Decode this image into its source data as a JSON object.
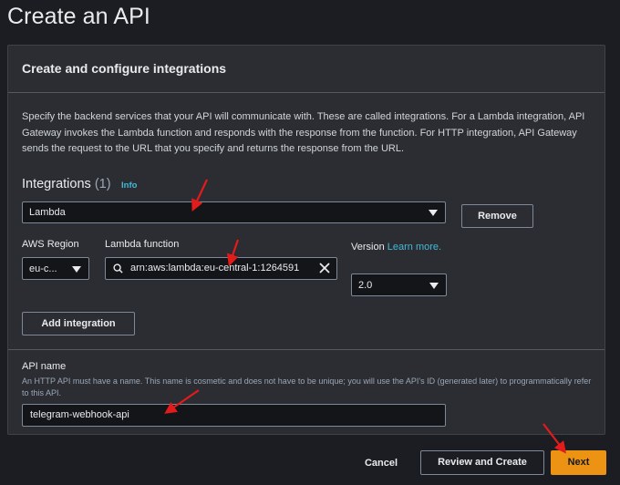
{
  "page": {
    "title": "Create an API"
  },
  "panel": {
    "title": "Create and configure integrations",
    "description": "Specify the backend services that your API will communicate with. These are called integrations. For a Lambda integration, API Gateway invokes the Lambda function and responds with the response from the function. For HTTP integration, API Gateway sends the request to the URL that you specify and returns the response from the URL."
  },
  "integrations": {
    "heading": "Integrations",
    "count": "(1)",
    "info_link": "Info",
    "type_value": "Lambda",
    "remove_label": "Remove",
    "region_label": "AWS Region",
    "region_value": "eu-c...",
    "lambda_label": "Lambda function",
    "lambda_value": "arn:aws:lambda:eu-central-1:1264591",
    "version_label": "Version",
    "version_learn_more": "Learn more.",
    "version_value": "2.0",
    "add_label": "Add integration"
  },
  "api": {
    "name_label": "API name",
    "name_hint": "An HTTP API must have a name. This name is cosmetic and does not have to be unique; you will use the API's ID (generated later) to programmatically refer to this API.",
    "name_value": "telegram-webhook-api"
  },
  "footer": {
    "cancel_label": "Cancel",
    "review_label": "Review and Create",
    "next_label": "Next"
  },
  "colors": {
    "background": "#1b1d22",
    "panel": "#2b2d32",
    "accent_link": "#44b9d6",
    "primary_button": "#ec9314",
    "annotation_arrow": "#e31b1b"
  },
  "icons": [
    "search-icon",
    "clear-icon",
    "caret-down-icon",
    "annotation-arrow"
  ]
}
